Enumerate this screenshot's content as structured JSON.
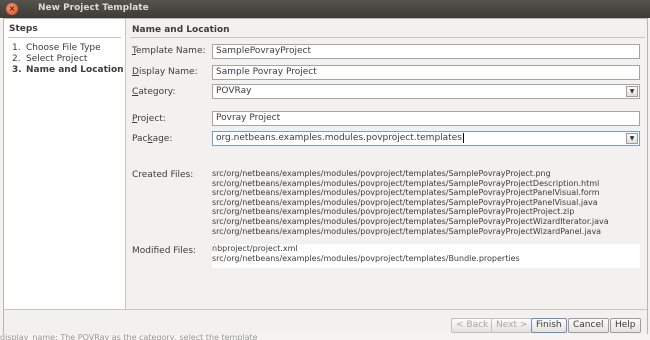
{
  "window": {
    "title": "New Project Template",
    "close_glyph": "×"
  },
  "steps": {
    "header": "Steps",
    "items": [
      {
        "num": "1.",
        "label": "Choose File Type"
      },
      {
        "num": "2.",
        "label": "Select Project"
      },
      {
        "num": "3.",
        "label": "Name and Location"
      }
    ],
    "current_index": 2
  },
  "main": {
    "title": "Name and Location",
    "template_name": {
      "label_pre": "",
      "label_mnemonic": "T",
      "label_post": "emplate Name:",
      "value": "SamplePovrayProject"
    },
    "display_name": {
      "label_pre": "",
      "label_mnemonic": "D",
      "label_post": "isplay Name:",
      "value": "Sample Povray Project"
    },
    "category": {
      "label_pre": "",
      "label_mnemonic": "C",
      "label_post": "ategory:",
      "value": "POVRay"
    },
    "project": {
      "label_pre": "",
      "label_mnemonic": "P",
      "label_post": "roject:",
      "value": "Povray Project"
    },
    "package": {
      "label_pre": "Pac",
      "label_mnemonic": "k",
      "label_post": "age:",
      "value": "org.netbeans.examples.modules.povproject.templates"
    },
    "created_files": {
      "label": "Created Files:",
      "files": [
        "src/org/netbeans/examples/modules/povproject/templates/SamplePovrayProject.png",
        "src/org/netbeans/examples/modules/povproject/templates/SamplePovrayProjectDescription.html",
        "src/org/netbeans/examples/modules/povproject/templates/SamplePovrayProjectPanelVisual.form",
        "src/org/netbeans/examples/modules/povproject/templates/SamplePovrayProjectPanelVisual.java",
        "src/org/netbeans/examples/modules/povproject/templates/SamplePovrayProjectProject.zip",
        "src/org/netbeans/examples/modules/povproject/templates/SamplePovrayProjectWizardIterator.java",
        "src/org/netbeans/examples/modules/povproject/templates/SamplePovrayProjectWizardPanel.java"
      ]
    },
    "modified_files": {
      "label": "Modified Files:",
      "files": [
        "nbproject/project.xml",
        "src/org/netbeans/examples/modules/povproject/templates/Bundle.properties"
      ]
    },
    "dropdown_glyph": "▼"
  },
  "buttons": {
    "back": "< Back",
    "next": "Next >",
    "finish": "Finish",
    "cancel": "Cancel",
    "help": "Help"
  },
  "background_text": "display_name:   The  POVRay  as the category, select the  template"
}
